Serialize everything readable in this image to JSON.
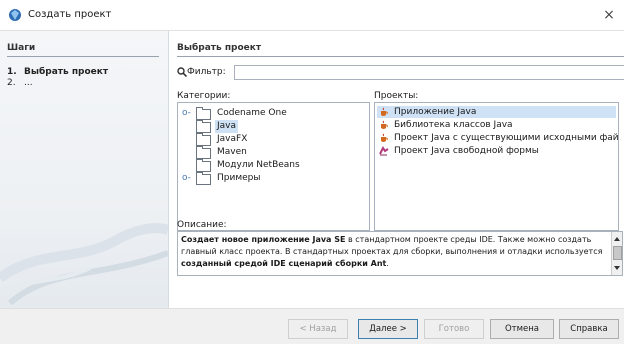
{
  "window": {
    "title": "Создать проект",
    "close_label": "×"
  },
  "steps": {
    "header": "Шаги",
    "items": [
      {
        "num": "1.",
        "label": "Выбрать проект"
      },
      {
        "num": "2.",
        "label": "..."
      }
    ]
  },
  "main": {
    "header": "Выбрать проект",
    "filter_label": "Фильтр:",
    "filter_value": "",
    "categories_label": "Категории:",
    "projects_label": "Проекты:",
    "categories": [
      {
        "label": "Codename One",
        "expandable": true
      },
      {
        "label": "Java",
        "selected": true
      },
      {
        "label": "JavaFX"
      },
      {
        "label": "Maven"
      },
      {
        "label": "Модули NetBeans"
      },
      {
        "label": "Примеры",
        "expandable": true
      }
    ],
    "projects": [
      {
        "label": "Приложение Java",
        "icon": "java-cup-icon",
        "selected": true
      },
      {
        "label": "Библиотека классов Java",
        "icon": "java-cup-icon"
      },
      {
        "label": "Проект Java с существующими исходными файлами",
        "icon": "java-cup-icon"
      },
      {
        "label": "Проект Java свободной формы",
        "icon": "freeform-project-icon"
      }
    ],
    "description_label": "Описание:",
    "description": {
      "bold1": "Создает новое приложение Java SE",
      "text1": " в стандартном проекте среды IDE. Также можно создать главный класс проекта. В стандартных проектах для сборки, выполнения и отладки используется ",
      "bold2": "созданный средой IDE сценарий сборки Ant",
      "text2": "."
    }
  },
  "buttons": {
    "back": "< Назад",
    "next": "Далее >",
    "finish": "Готово",
    "cancel": "Отмена",
    "help": "Справка"
  },
  "colors": {
    "selection": "#cfe1f5",
    "accent": "#3c7fb1"
  }
}
